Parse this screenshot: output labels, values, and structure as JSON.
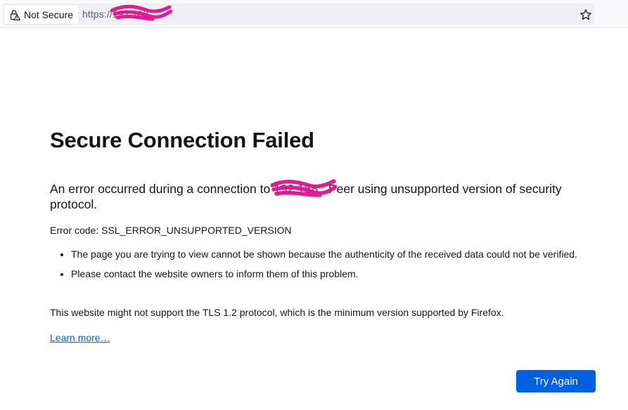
{
  "browser": {
    "identity_label": "Not Secure",
    "url_scheme": "https://",
    "url_host_fragment": "192.168.",
    "icons": [
      "lock-warning-icon",
      "bookmark-star-icon"
    ]
  },
  "error_page": {
    "title": "Secure Connection Failed",
    "intro_before": "An error occurred during a connection to ",
    "intro_host": "192.168.",
    "intro_after": ". Peer using unsupported version of security protocol.",
    "error_code": "Error code: SSL_ERROR_UNSUPPORTED_VERSION",
    "bullets": [
      "The page you are trying to view cannot be shown because the authenticity of the received data could not be verified.",
      "Please contact the website owners to inform them of this problem."
    ],
    "tls_note": "This website might not support the TLS 1.2 protocol, which is the minimum version supported by Firefox.",
    "learn_more": "Learn more…",
    "try_again": "Try Again"
  },
  "colors": {
    "accent": "#0061e0",
    "redaction": "#e0108c",
    "text": "#15141a"
  }
}
